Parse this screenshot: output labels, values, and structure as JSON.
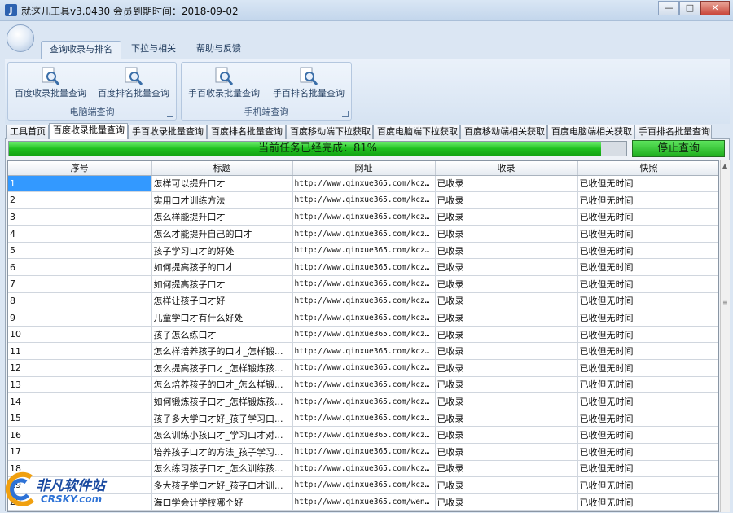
{
  "window": {
    "title": "就这儿工具v3.0430  会员到期时间：2018-09-02",
    "app_icon": "J",
    "controls": {
      "minimize": "—",
      "maximize": "□",
      "close": "✕"
    }
  },
  "ribbon": {
    "tabs": [
      "查询收录与排名",
      "下拉与相关",
      "帮助与反馈"
    ],
    "groups": [
      {
        "label": "电脑端查询",
        "buttons": [
          "百度收录批量查询",
          "百度排名批量查询"
        ]
      },
      {
        "label": "手机端查询",
        "buttons": [
          "手百收录批量查询",
          "手百排名批量查询"
        ]
      }
    ]
  },
  "doc_tabs": [
    "工具首页",
    "百度收录批量查询",
    "手百收录批量查询",
    "百度排名批量查询",
    "百度移动端下拉获取",
    "百度电脑端下拉获取",
    "百度移动端相关获取",
    "百度电脑端相关获取",
    "手百排名批量查询"
  ],
  "progress": {
    "text": "当前任务已经完成：81%",
    "percent": 95.9
  },
  "stop_button": "停止查询",
  "table": {
    "headers": [
      "序号",
      "标题",
      "网址",
      "收录",
      "快照"
    ],
    "rows": [
      [
        "1",
        "怎样可以提升口才",
        "http://www.qinxue365.com/kcz...",
        "已收录",
        "已收但无时间"
      ],
      [
        "2",
        "实用口才训练方法",
        "http://www.qinxue365.com/kcz...",
        "已收录",
        "已收但无时间"
      ],
      [
        "3",
        "怎么样能提升口才",
        "http://www.qinxue365.com/kcz...",
        "已收录",
        "已收但无时间"
      ],
      [
        "4",
        "怎么才能提升自己的口才",
        "http://www.qinxue365.com/kcz...",
        "已收录",
        "已收但无时间"
      ],
      [
        "5",
        "孩子学习口才的好处",
        "http://www.qinxue365.com/kcz...",
        "已收录",
        "已收但无时间"
      ],
      [
        "6",
        "如何提高孩子的口才",
        "http://www.qinxue365.com/kcz...",
        "已收录",
        "已收但无时间"
      ],
      [
        "7",
        "如何提高孩子口才",
        "http://www.qinxue365.com/kcz...",
        "已收录",
        "已收但无时间"
      ],
      [
        "8",
        "怎样让孩子口才好",
        "http://www.qinxue365.com/kcz...",
        "已收录",
        "已收但无时间"
      ],
      [
        "9",
        "儿童学口才有什么好处",
        "http://www.qinxue365.com/kcz...",
        "已收录",
        "已收但无时间"
      ],
      [
        "10",
        "孩子怎么练口才",
        "http://www.qinxue365.com/kcz...",
        "已收录",
        "已收但无时间"
      ],
      [
        "11",
        " 怎么样培养孩子的口才_怎样锻...",
        "http://www.qinxue365.com/kcz...",
        "已收录",
        "已收但无时间"
      ],
      [
        "12",
        "怎么提高孩子口才_怎样锻炼孩...",
        "http://www.qinxue365.com/kcz...",
        "已收录",
        "已收但无时间"
      ],
      [
        "13",
        "怎么培养孩子的口才_怎么样锻...",
        "http://www.qinxue365.com/kcz...",
        "已收录",
        "已收但无时间"
      ],
      [
        "14",
        "如何锻炼孩子口才_怎样锻炼孩...",
        "http://www.qinxue365.com/kcz...",
        "已收录",
        "已收但无时间"
      ],
      [
        "15",
        "孩子多大学口才好_孩子学习口...",
        "http://www.qinxue365.com/kcz...",
        "已收录",
        "已收但无时间"
      ],
      [
        "16",
        "怎么训练小孩口才_学习口才对...",
        "http://www.qinxue365.com/kcz...",
        "已收录",
        "已收但无时间"
      ],
      [
        "17",
        "培养孩子口才的方法_孩子学习...",
        "http://www.qinxue365.com/kcz...",
        "已收录",
        "已收但无时间"
      ],
      [
        "18",
        "怎么练习孩子口才_怎么训练孩...",
        "http://www.qinxue365.com/kcz...",
        "已收录",
        "已收但无时间"
      ],
      [
        "19",
        "多大孩子学口才好_孩子口才训...",
        "http://www.qinxue365.com/kcz...",
        "已收录",
        "已收但无时间"
      ],
      [
        "20",
        "海口学会计学校哪个好",
        "http://www.qinxue365.com/wen...",
        "已收录",
        "已收但无时间"
      ]
    ]
  },
  "watermark": {
    "cn": "非凡软件站",
    "en": "CRSKY.com"
  },
  "colors": {
    "progress_green": "#20c020",
    "selection_blue": "#3399ff",
    "ribbon_blue": "#dbe6f3"
  }
}
